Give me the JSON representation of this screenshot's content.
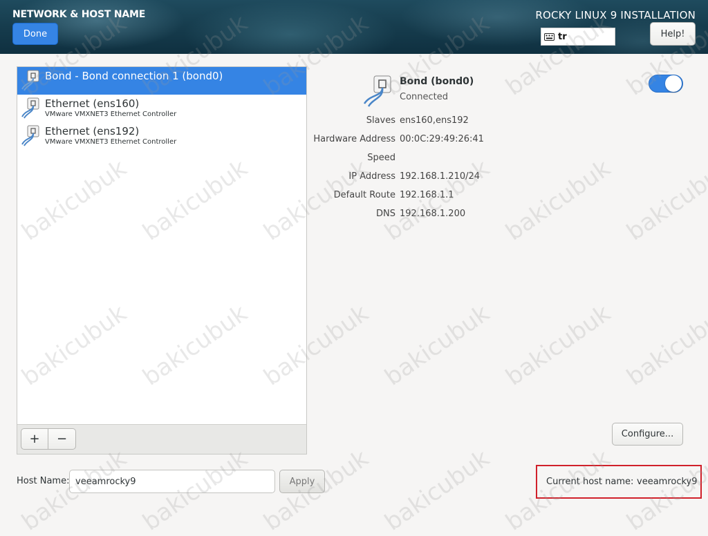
{
  "header": {
    "spoke_title": "NETWORK & HOST NAME",
    "done_label": "Done",
    "product_title": "ROCKY LINUX 9 INSTALLATION",
    "keyboard_layout": "tr",
    "keyboard_icon": "keyboard-icon",
    "help_label": "Help!"
  },
  "devices": [
    {
      "name": "Bond - Bond connection 1 (bond0)",
      "description": "",
      "selected": true,
      "icon": "network-wired-icon"
    },
    {
      "name": "Ethernet (ens160)",
      "description": "VMware VMXNET3 Ethernet Controller",
      "selected": false,
      "icon": "network-wired-icon"
    },
    {
      "name": "Ethernet (ens192)",
      "description": "VMware VMXNET3 Ethernet Controller",
      "selected": false,
      "icon": "network-wired-icon"
    }
  ],
  "list_toolbar": {
    "add_label": "+",
    "remove_label": "−"
  },
  "details": {
    "name": "Bond (bond0)",
    "status": "Connected",
    "toggle_on": true,
    "rows": [
      {
        "label": "Slaves",
        "value": "ens160,ens192"
      },
      {
        "label": "Hardware Address",
        "value": "00:0C:29:49:26:41"
      },
      {
        "label": "Speed",
        "value": ""
      },
      {
        "label": "IP Address",
        "value": "192.168.1.210/24"
      },
      {
        "label": "Default Route",
        "value": "192.168.1.1"
      },
      {
        "label": "DNS",
        "value": "192.168.1.200"
      }
    ],
    "configure_label": "Configure..."
  },
  "hostname": {
    "label": "Host Name:",
    "value": "veeamrocky9",
    "apply_label": "Apply",
    "current_label": "Current host name:",
    "current_value": "veeamrocky9"
  },
  "watermark": "bakicubuk",
  "colors": {
    "accent": "#3584e4",
    "highlight_border": "#d0202a"
  }
}
